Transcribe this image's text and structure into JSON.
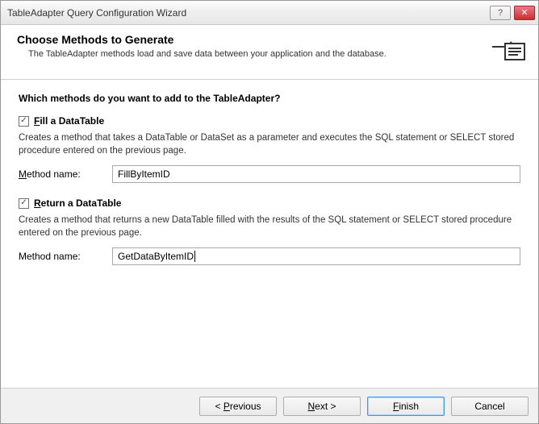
{
  "window": {
    "title": "TableAdapter Query Configuration Wizard",
    "help_glyph": "?",
    "close_glyph": "✕"
  },
  "header": {
    "title": "Choose Methods to Generate",
    "desc": "The TableAdapter methods load and save data between your application and the database."
  },
  "content": {
    "prompt": "Which methods do you want to add to the TableAdapter?",
    "fill": {
      "checked": true,
      "label_pre": "F",
      "label_post": "ill a DataTable",
      "desc": "Creates a method that takes a DataTable or DataSet as a parameter and executes the SQL statement or SELECT stored procedure entered on the previous page.",
      "name_label_pre": "M",
      "name_label_post": "ethod name:",
      "value": "FillByItemID"
    },
    "ret": {
      "checked": true,
      "label_pre": "R",
      "label_post": "eturn a DataTable",
      "desc": "Creates a method that returns a new DataTable filled with the results of the SQL statement or SELECT stored procedure entered on the previous page.",
      "name_label": "Method name:",
      "value": "GetDataByItemID"
    }
  },
  "footer": {
    "previous": "< Previous",
    "next": "Next >",
    "finish": "Finish",
    "cancel": "Cancel"
  }
}
